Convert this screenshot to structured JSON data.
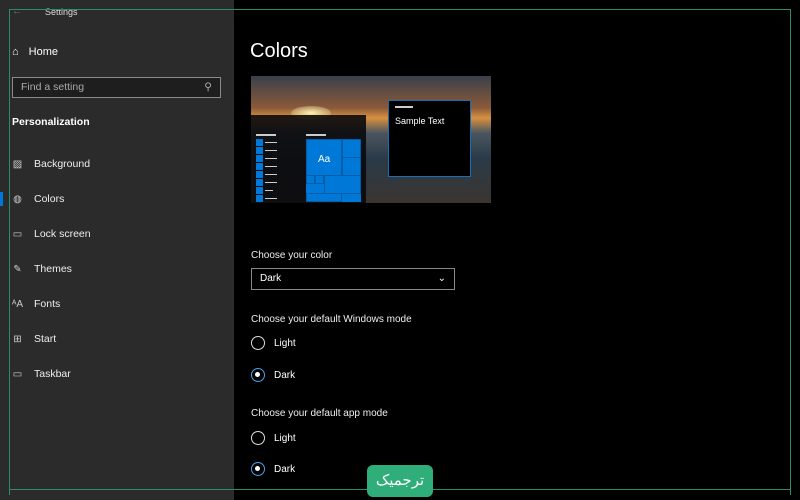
{
  "window": {
    "title": "Settings",
    "back_icon": "arrow-left-icon"
  },
  "sidebar": {
    "home": "Home",
    "search_placeholder": "Find a setting",
    "section": "Personalization",
    "items": [
      {
        "label": "Background",
        "icon": "image-icon"
      },
      {
        "label": "Colors",
        "icon": "palette-icon",
        "selected": true
      },
      {
        "label": "Lock screen",
        "icon": "lock-screen-icon"
      },
      {
        "label": "Themes",
        "icon": "themes-icon"
      },
      {
        "label": "Fonts",
        "icon": "fonts-icon"
      },
      {
        "label": "Start",
        "icon": "start-icon"
      },
      {
        "label": "Taskbar",
        "icon": "taskbar-icon"
      }
    ]
  },
  "main": {
    "title": "Colors",
    "preview": {
      "sample_text": "Sample Text",
      "tile_label": "Aa"
    },
    "choose_color": {
      "label": "Choose your color",
      "value": "Dark"
    },
    "windows_mode": {
      "label": "Choose your default Windows mode",
      "options": [
        "Light",
        "Dark"
      ],
      "selected": "Dark"
    },
    "app_mode": {
      "label": "Choose your default app mode",
      "options": [
        "Light",
        "Dark"
      ],
      "selected": "Dark"
    }
  },
  "colors": {
    "accent": "#0078d7",
    "sidebar_bg": "#2b2b2b",
    "logo_bg": "#2fae7a"
  },
  "logo": {
    "text": "ترجمیک"
  }
}
